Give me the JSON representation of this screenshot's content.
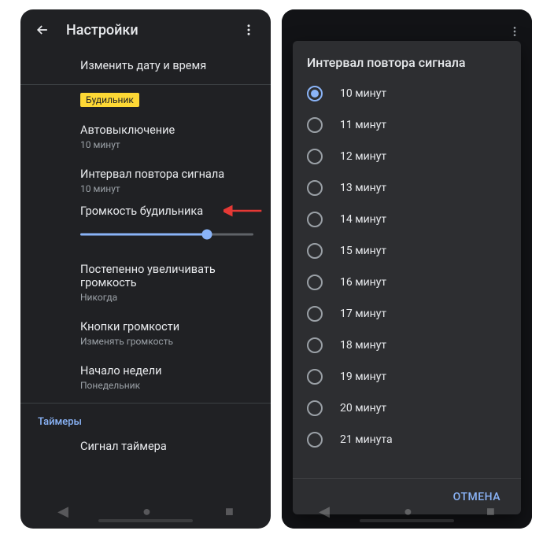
{
  "left": {
    "title": "Настройки",
    "item_datetime": "Изменить дату и время",
    "chip": "Будильник",
    "auto_off": {
      "title": "Автовыключение",
      "sub": "10 минут"
    },
    "snooze": {
      "title": "Интервал повтора сигнала",
      "sub": "10 минут"
    },
    "volume_title": "Громкость будильника",
    "gradual": {
      "title": "Постепенно увеличивать громкость",
      "sub": "Никогда"
    },
    "vol_buttons": {
      "title": "Кнопки громкости",
      "sub": "Изменять громкость"
    },
    "week_start": {
      "title": "Начало недели",
      "sub": "Понедельник"
    },
    "section_timers": "Таймеры",
    "timer_sound": "Сигнал таймера"
  },
  "dialog": {
    "title": "Интервал повтора сигнала",
    "selected_index": 0,
    "options": [
      "10 минут",
      "11 минут",
      "12  минут",
      "13 минут",
      "14 минут",
      "15 минут",
      "16 минут",
      "17 минут",
      "18 минут",
      "19 минут",
      "20 минут",
      "21 минута"
    ],
    "cancel": "ОТМЕНА"
  }
}
